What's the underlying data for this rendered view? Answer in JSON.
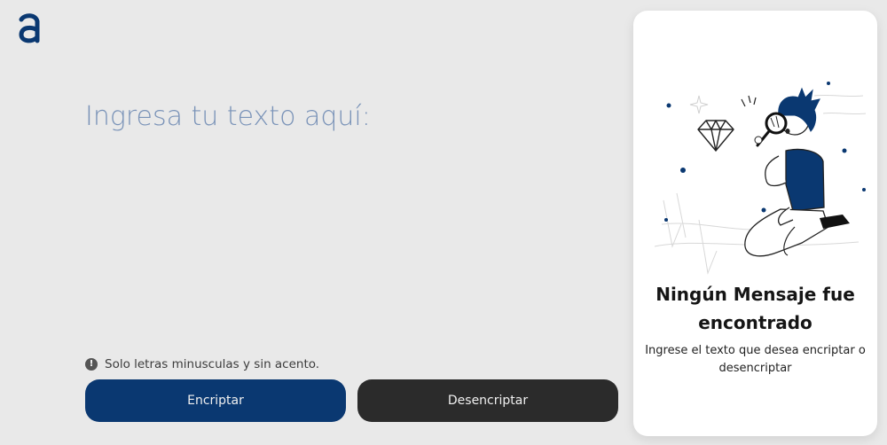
{
  "brand": {
    "logo_icon": "alura-a-logo-icon",
    "accent_color": "#0a3871"
  },
  "editor": {
    "placeholder": "Ingresa tu texto aquí:",
    "value": ""
  },
  "hint": {
    "icon": "exclamation-circle-icon",
    "text": "Solo letras minusculas y sin acento."
  },
  "actions": {
    "encrypt_label": "Encriptar",
    "decrypt_label": "Desencriptar",
    "encrypt_color": "#0a3871",
    "decrypt_color": "#2b2b2b"
  },
  "result_panel": {
    "illustration": "person-with-magnifier-illustration",
    "title": "Ningún Mensaje fue encontrado",
    "message": "Ingrese el texto que desea encriptar o desencriptar"
  }
}
